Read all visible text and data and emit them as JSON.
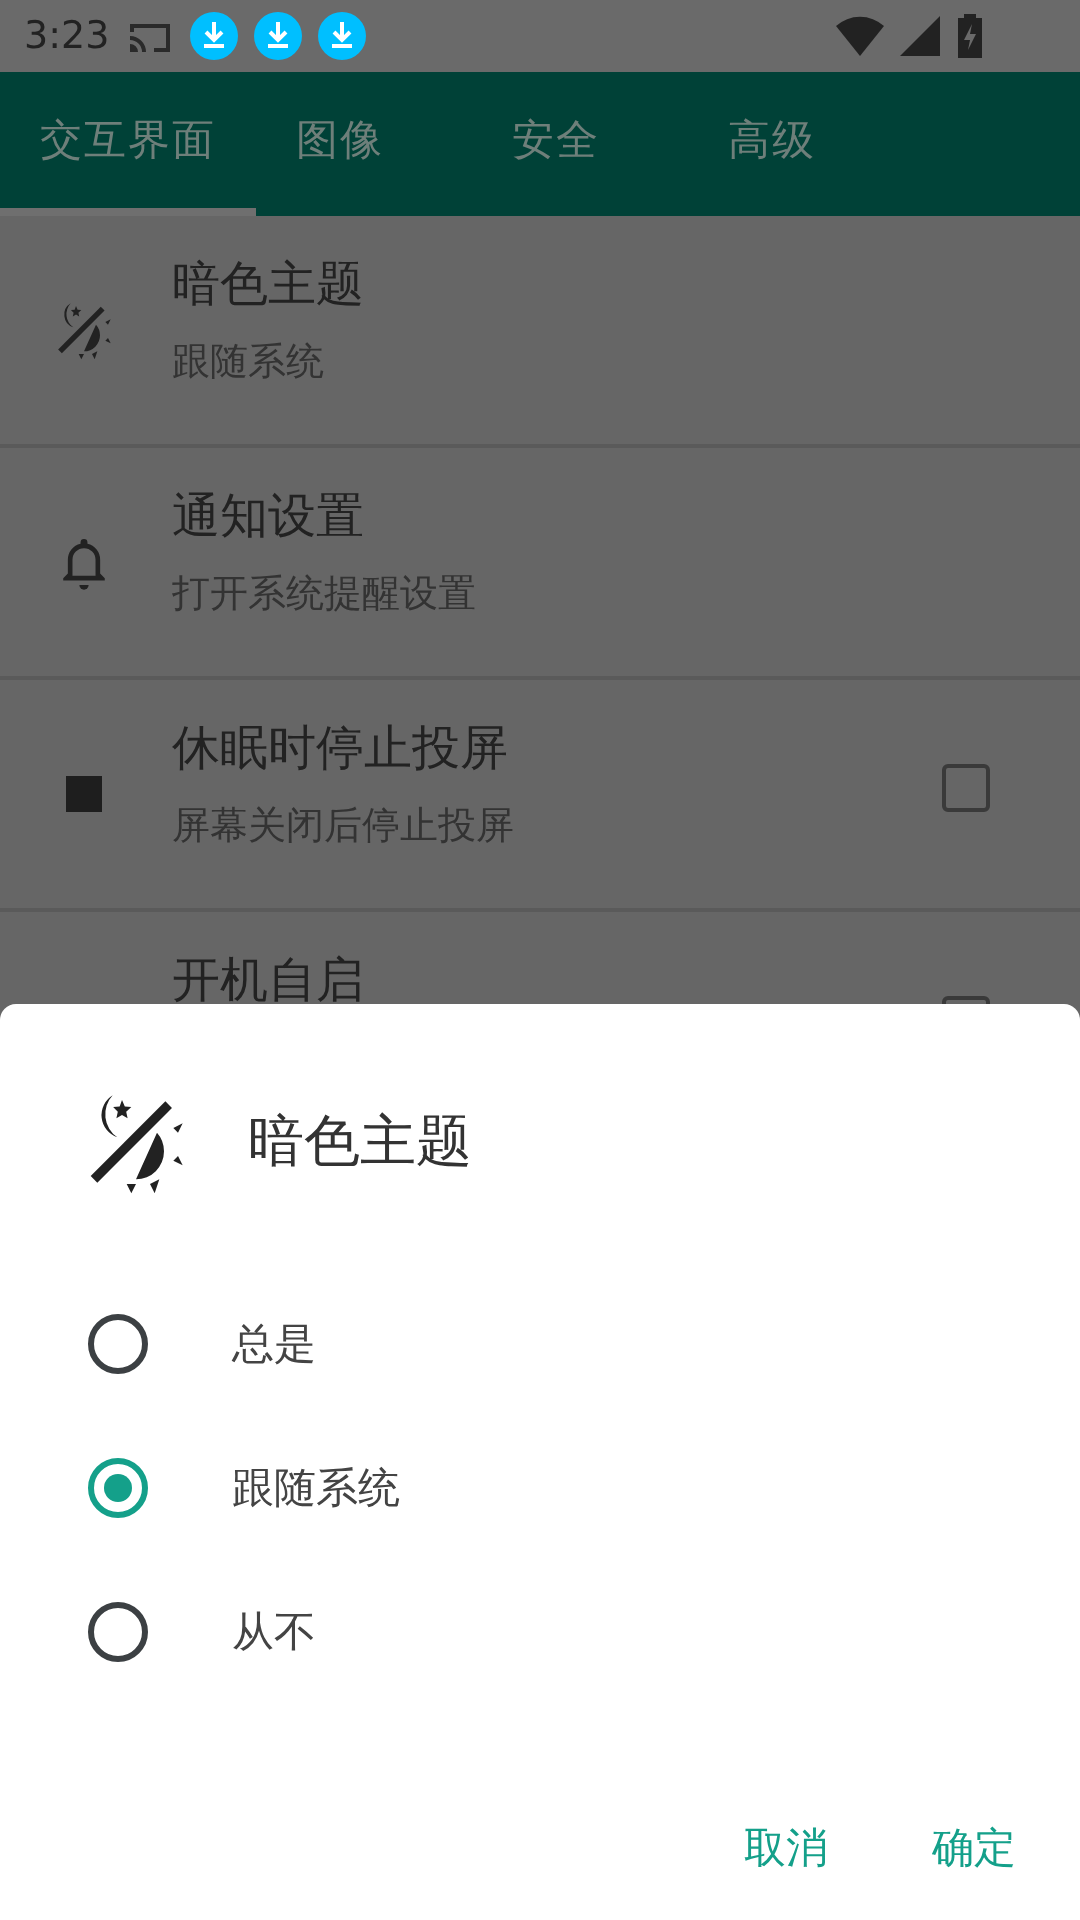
{
  "status_bar": {
    "time": "3:23"
  },
  "tabs": [
    {
      "label": "交互界面",
      "selected": true
    },
    {
      "label": "图像",
      "selected": false
    },
    {
      "label": "安全",
      "selected": false
    },
    {
      "label": "高级",
      "selected": false
    }
  ],
  "settings": [
    {
      "kind": "plain",
      "title": "暗色主题",
      "subtitle": "跟随系统"
    },
    {
      "kind": "plain",
      "title": "通知设置",
      "subtitle": "打开系统提醒设置"
    },
    {
      "kind": "checkbox",
      "title": "休眠时停止投屏",
      "subtitle": "屏幕关闭后停止投屏",
      "checked": false
    },
    {
      "kind": "checkbox",
      "title": "开机自启",
      "checked": false
    }
  ],
  "dialog": {
    "title": "暗色主题",
    "options": [
      {
        "label": "总是",
        "selected": false
      },
      {
        "label": "跟随系统",
        "selected": true
      },
      {
        "label": "从不",
        "selected": false
      }
    ],
    "buttons": [
      "取消",
      "确定"
    ]
  }
}
